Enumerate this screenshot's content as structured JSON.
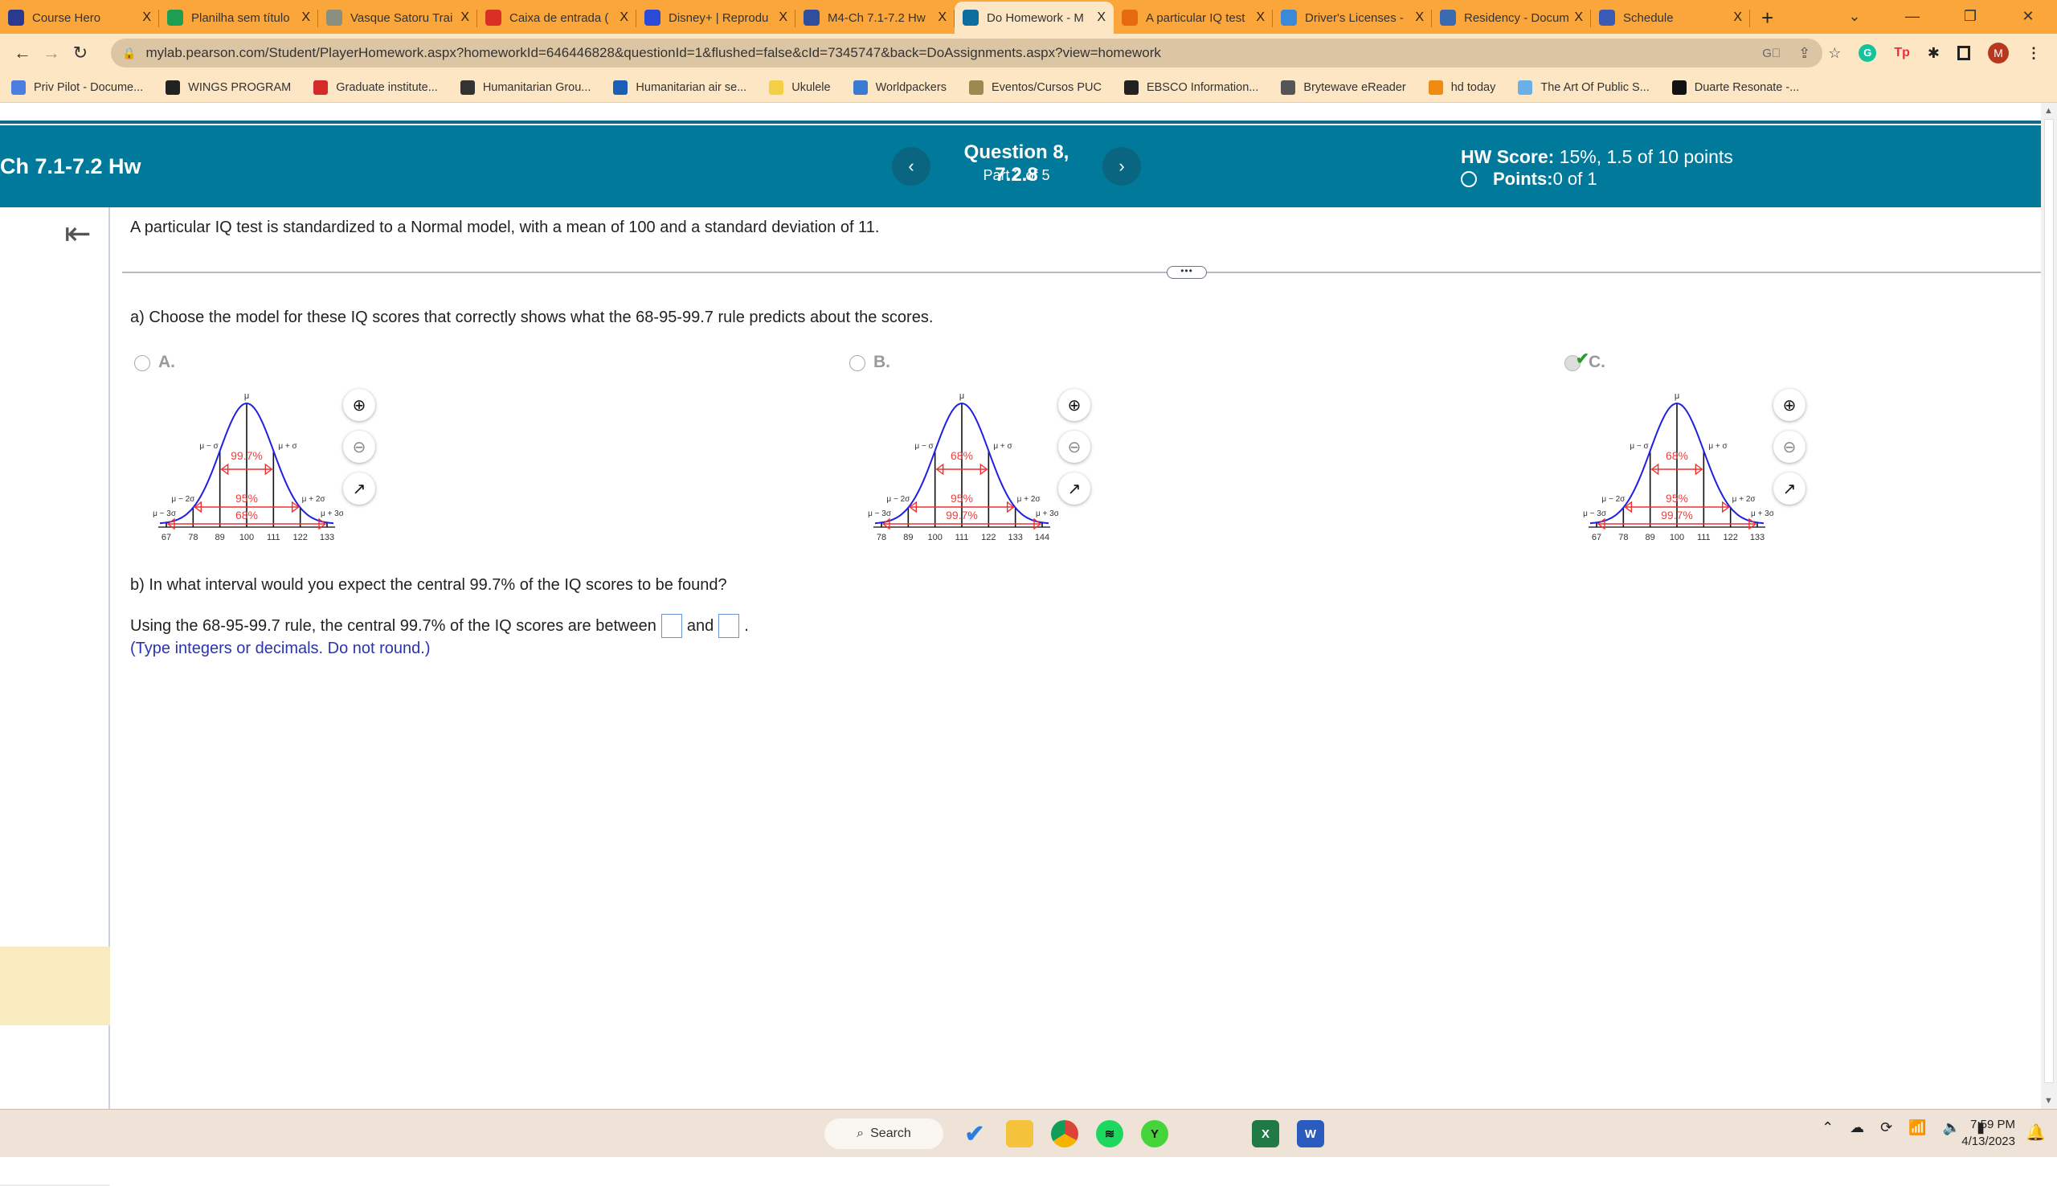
{
  "browser": {
    "tabs": [
      {
        "label": "Course Hero",
        "icon": "coursehero-icon",
        "color": "#2b3a8f"
      },
      {
        "label": "Planilha sem título",
        "icon": "sheets-icon",
        "color": "#1e9e52"
      },
      {
        "label": "Vasque Satoru Trai",
        "icon": "figure-icon",
        "color": "#8a8f80"
      },
      {
        "label": "Caixa de entrada (",
        "icon": "gmail-icon",
        "color": "#d93025"
      },
      {
        "label": "Disney+ | Reprodu",
        "icon": "disney-icon",
        "color": "#2a4bd7"
      },
      {
        "label": "M4-Ch 7.1-7.2 Hw",
        "icon": "e-icon",
        "color": "#2f4f9e"
      },
      {
        "label": "Do Homework - M",
        "icon": "pearson-icon",
        "color": "#0d6e9e",
        "active": true
      },
      {
        "label": "A particular IQ test",
        "icon": "chegg-icon",
        "color": "#e86a10"
      },
      {
        "label": "Driver's Licenses -",
        "icon": "steering-icon",
        "color": "#3a8ad9"
      },
      {
        "label": "Residency - Docum",
        "icon": "seal-icon",
        "color": "#3a6ab0"
      },
      {
        "label": "Schedule",
        "icon": "schedule-icon",
        "color": "#3b5bb5"
      }
    ],
    "close_glyph": "X",
    "new_tab": "+",
    "window_controls": [
      "⌄",
      "—",
      "❐",
      "✕"
    ],
    "url": "mylab.pearson.com/Student/PlayerHomework.aspx?homeworkId=646446828&questionId=1&flushed=false&cId=7345747&back=DoAssignments.aspx?view=homework",
    "profile_initial": "M",
    "bookmarks": [
      {
        "label": "Priv Pilot - Docume...",
        "color": "#4a7fe0"
      },
      {
        "label": "WINGS PROGRAM",
        "color": "#222"
      },
      {
        "label": "Graduate institute...",
        "color": "#d42a2a"
      },
      {
        "label": "Humanitarian Grou...",
        "color": "#333"
      },
      {
        "label": "Humanitarian air se...",
        "color": "#1a5fb4"
      },
      {
        "label": "Ukulele",
        "color": "#f3d046"
      },
      {
        "label": "Worldpackers",
        "color": "#3a7ad0"
      },
      {
        "label": "Eventos/Cursos PUC",
        "color": "#9a8a50"
      },
      {
        "label": "EBSCO Information...",
        "color": "#222"
      },
      {
        "label": "Brytewave eReader",
        "color": "#555"
      },
      {
        "label": "hd today",
        "color": "#f08a10"
      },
      {
        "label": "The Art Of Public S...",
        "color": "#6ab0e6"
      },
      {
        "label": "Duarte Resonate -...",
        "color": "#111"
      }
    ]
  },
  "header": {
    "assignment_title": "Ch 7.1-7.2 Hw",
    "question_title": "Question 8, 7.2.8",
    "question_part": "Part 2 of 5",
    "prev": "‹",
    "next": "›",
    "hw_score_label": "HW Score:",
    "hw_score_value": " 15%, 1.5 of 10 points",
    "points_label": "Points:",
    "points_value": " 0 of 1"
  },
  "question": {
    "stem": "A particular IQ test is standardized to a Normal model, with a mean of 100 and a standard deviation of 11.",
    "more": "•••",
    "part_a": "a) Choose the model for these IQ scores that correctly shows what the 68-95-99.7 rule predicts about the scores.",
    "options": [
      {
        "label": "A.",
        "selected": false,
        "ticks": [
          "67",
          "78",
          "89",
          "100",
          "111",
          "122",
          "133"
        ],
        "inner": "99.7%",
        "middle": "95%",
        "outer": "68%"
      },
      {
        "label": "B.",
        "selected": false,
        "ticks": [
          "78",
          "89",
          "100",
          "111",
          "122",
          "133",
          "144"
        ],
        "inner": "68%",
        "middle": "95%",
        "outer": "99.7%"
      },
      {
        "label": "C.",
        "selected": true,
        "correct": true,
        "ticks": [
          "67",
          "78",
          "89",
          "100",
          "111",
          "122",
          "133"
        ],
        "inner": "68%",
        "middle": "95%",
        "outer": "99.7%"
      }
    ],
    "sigma_labels": {
      "mu": "μ",
      "m1": "μ − σ",
      "p1": "μ + σ",
      "m2": "μ − 2σ",
      "p2": "μ + 2σ",
      "m3": "μ − 3σ",
      "p3": "μ + 3σ"
    },
    "part_b": "b) In what interval would you expect the central 99.7% of the IQ scores to be found?",
    "answer_prefix": "Using the 68-95-99.7 rule, the central 99.7% of the IQ scores are between",
    "answer_and": "and",
    "answer_suffix": ".",
    "answer_low": "",
    "answer_high": "",
    "hint": "(Type integers or decimals. Do not round.)"
  },
  "taskbar": {
    "search_label": "Search",
    "time": "7:59 PM",
    "date": "4/13/2023"
  }
}
